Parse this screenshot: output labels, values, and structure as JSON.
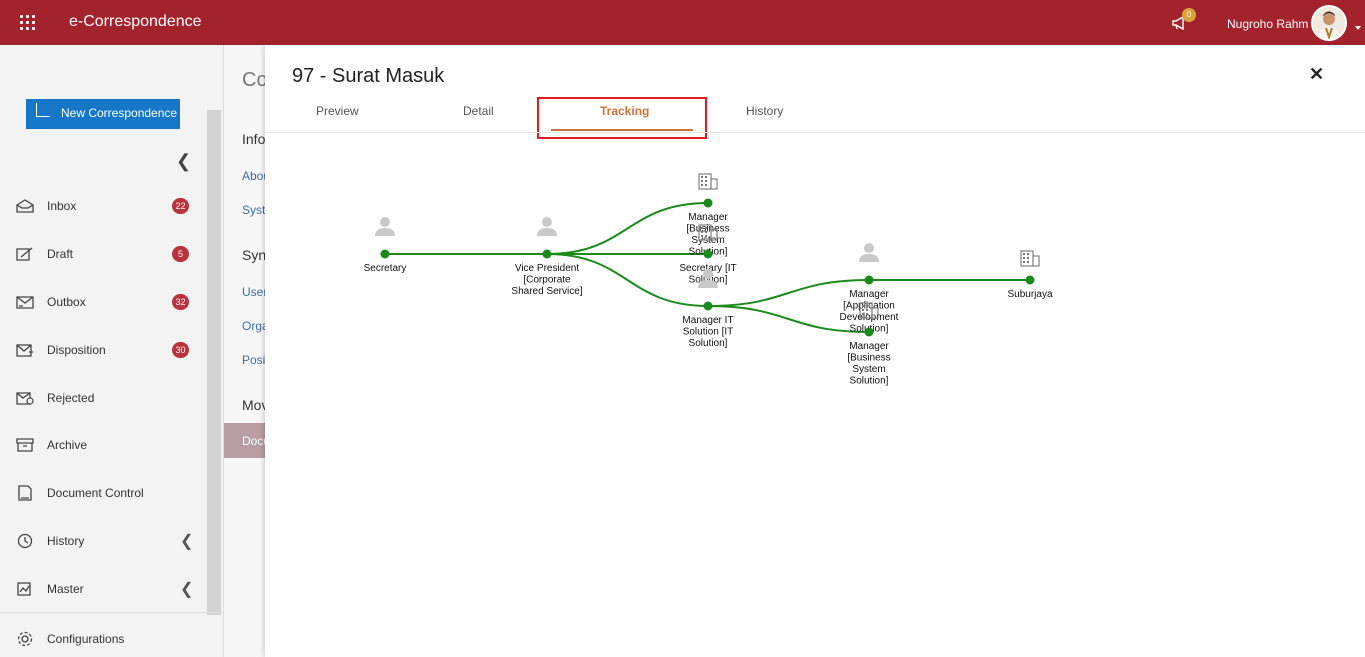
{
  "app": {
    "title": "e-Correspondence"
  },
  "header": {
    "notification_count": "0",
    "user_name": "Nugroho Rahm"
  },
  "sidebar": {
    "new_button_label": "New Correspondence",
    "items": [
      {
        "label": "Inbox",
        "badge": "22",
        "icon": "inbox-icon"
      },
      {
        "label": "Draft",
        "badge": "5",
        "icon": "draft-icon"
      },
      {
        "label": "Outbox",
        "badge": "32",
        "icon": "outbox-icon"
      },
      {
        "label": "Disposition",
        "badge": "30",
        "icon": "disposition-icon"
      },
      {
        "label": "Rejected",
        "badge": "",
        "icon": "rejected-icon"
      },
      {
        "label": "Archive",
        "badge": "",
        "icon": "archive-icon"
      },
      {
        "label": "Document Control",
        "badge": "",
        "icon": "document-control-icon"
      },
      {
        "label": "History",
        "badge": "",
        "icon": "history-icon"
      },
      {
        "label": "Master",
        "badge": "",
        "icon": "master-icon"
      },
      {
        "label": "Configurations",
        "badge": "",
        "icon": "gear-icon"
      }
    ]
  },
  "background_panel": {
    "title": "Co",
    "sections": [
      "Info",
      "Abou",
      "Syst",
      "Syn",
      "User",
      "Orga",
      "Posi",
      "Mov",
      "Docu"
    ]
  },
  "modal": {
    "title": "97 - Surat Masuk",
    "tabs": [
      "Preview",
      "Detail",
      "Tracking",
      "History"
    ],
    "active_tab": "Tracking",
    "close_label": "✕"
  },
  "tracking_nodes": [
    {
      "id": "n1",
      "label": [
        "Secretary"
      ],
      "kind": "person"
    },
    {
      "id": "n2",
      "label": [
        "Vice President",
        "[Corporate",
        "Shared Service]"
      ],
      "kind": "person"
    },
    {
      "id": "n3",
      "label": [
        "Manager",
        "[Business",
        "System",
        "Solution]"
      ],
      "kind": "building"
    },
    {
      "id": "n4",
      "label": [
        "Secretary [IT",
        "Solution]"
      ],
      "kind": "building"
    },
    {
      "id": "n5",
      "label": [
        "Manager IT",
        "Solution [IT",
        "Solution]"
      ],
      "kind": "person"
    },
    {
      "id": "n6",
      "label": [
        "Manager",
        "[Application",
        "Development",
        "Solution]"
      ],
      "kind": "person"
    },
    {
      "id": "n7",
      "label": [
        "Manager",
        "[Business",
        "System",
        "Solution]"
      ],
      "kind": "building"
    },
    {
      "id": "n8",
      "label": [
        "Suburjaya"
      ],
      "kind": "building"
    }
  ],
  "colors": {
    "header": "#a3232d",
    "accent": "#c8743a",
    "edge": "#1a8a1a",
    "badge": "#b8333b",
    "primary_button": "#1677c8"
  }
}
